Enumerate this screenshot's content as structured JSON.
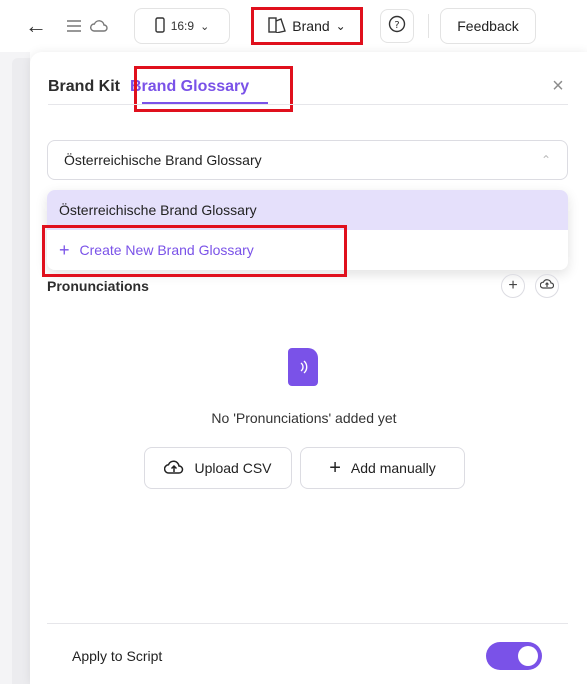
{
  "topbar": {
    "ratio_label": "16:9",
    "brand_label": "Brand",
    "feedback_label": "Feedback"
  },
  "panel": {
    "tabs": [
      {
        "label": "Brand Kit"
      },
      {
        "label": "Brand Glossary"
      }
    ],
    "select": {
      "value": "Österreichische Brand Glossary"
    },
    "dropdown": {
      "items": [
        {
          "label": "Österreichische Brand Glossary"
        },
        {
          "label": "Create New Brand Glossary"
        }
      ]
    },
    "pronunciations_label": "Pronunciations",
    "empty_text": "No 'Pronunciations' added yet",
    "upload_csv_label": "Upload CSV",
    "add_manually_label": "Add manually",
    "apply_label": "Apply to Script"
  },
  "colors": {
    "accent": "#7a52e8",
    "highlight": "#e0101d",
    "selected_bg": "#e5e0fb"
  }
}
